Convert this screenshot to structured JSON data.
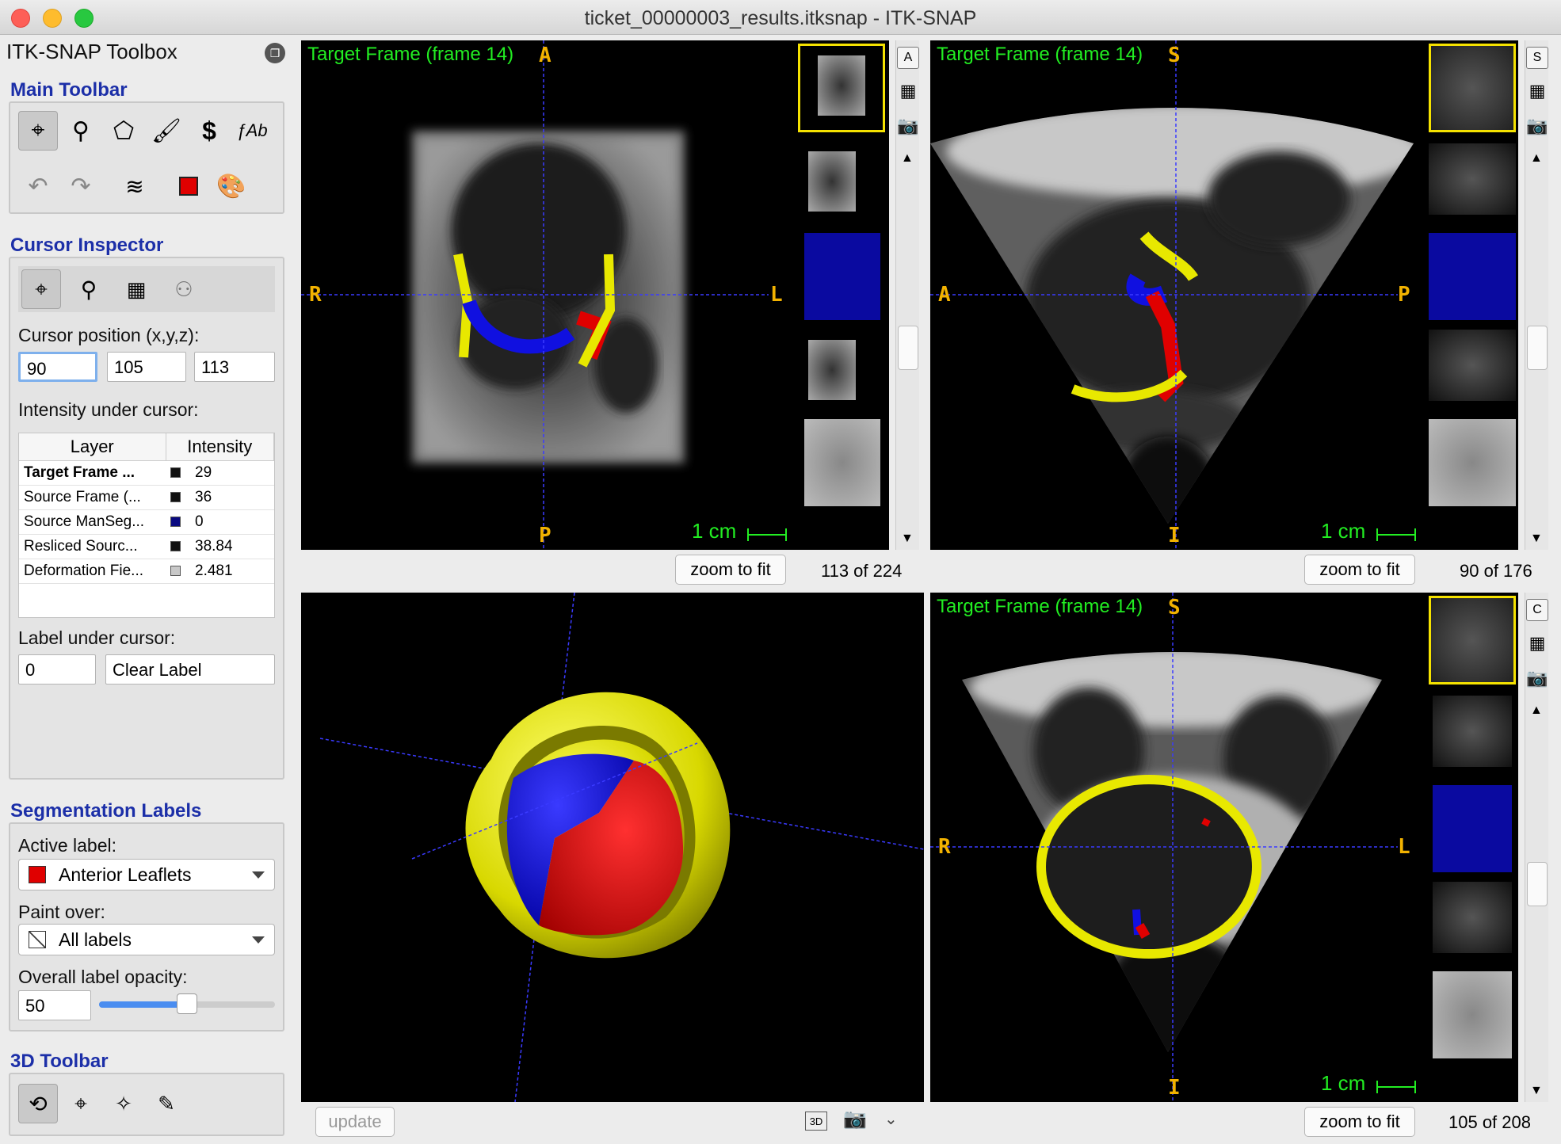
{
  "window": {
    "title": "ticket_00000003_results.itksnap - ITK-SNAP"
  },
  "toolbox": {
    "title": "ITK-SNAP Toolbox"
  },
  "main_toolbar": {
    "heading": "Main Toolbar"
  },
  "cursor_inspector": {
    "heading": "Cursor Inspector",
    "position_label": "Cursor position (x,y,z):",
    "x": "90",
    "y": "105",
    "z": "113",
    "intensity_label": "Intensity under cursor:",
    "columns": [
      "Layer",
      "Intensity"
    ],
    "rows": [
      {
        "layer": "Target Frame ...",
        "value": "29",
        "swatch": "#111111"
      },
      {
        "layer": "Source Frame (...",
        "value": "36",
        "swatch": "#111111"
      },
      {
        "layer": "Source ManSeg...",
        "value": "0",
        "swatch": "#0a0a80"
      },
      {
        "layer": "Resliced Sourc...",
        "value": "38.84",
        "swatch": "#111111"
      },
      {
        "layer": "Deformation Fie...",
        "value": "2.481",
        "swatch": "#c8c8c8"
      }
    ],
    "label_under_cursor": "Label under cursor:",
    "label_value": "0",
    "label_name": "Clear Label"
  },
  "seg_labels": {
    "heading": "Segmentation Labels",
    "active_label_caption": "Active label:",
    "active_label": "Anterior Leaflets",
    "active_color": "#e00000",
    "paint_over_caption": "Paint over:",
    "paint_over": "All labels",
    "opacity_caption": "Overall label opacity:",
    "opacity_value": "50",
    "opacity_fraction": 0.5
  },
  "toolbar3d": {
    "heading": "3D Toolbar"
  },
  "views": {
    "axial": {
      "title": "Target Frame (frame 14)",
      "top": "A",
      "bottom": "P",
      "left": "R",
      "right": "L",
      "scale": "1 cm",
      "zoom": "zoom to fit",
      "slice": "113 of 224",
      "side_icon": "A"
    },
    "sagittal": {
      "title": "Target Frame (frame 14)",
      "top": "S",
      "bottom": "I",
      "left": "A",
      "right": "P",
      "scale": "1 cm",
      "zoom": "zoom to fit",
      "slice": "90 of 176",
      "side_icon": "S"
    },
    "coronal": {
      "title": "Target Frame (frame 14)",
      "top": "S",
      "bottom": "I",
      "left": "R",
      "right": "L",
      "scale": "1 cm",
      "zoom": "zoom to fit",
      "slice": "105 of 208",
      "side_icon": "C"
    },
    "render3d": {
      "update": "update",
      "badge": "3D"
    }
  },
  "colors": {
    "accent": "#1c2fa8",
    "label_yellow": "#e8e800",
    "label_blue": "#1010e0",
    "label_red": "#e00000",
    "orientation": "#f2b200",
    "overlay_green": "#22ee22"
  }
}
